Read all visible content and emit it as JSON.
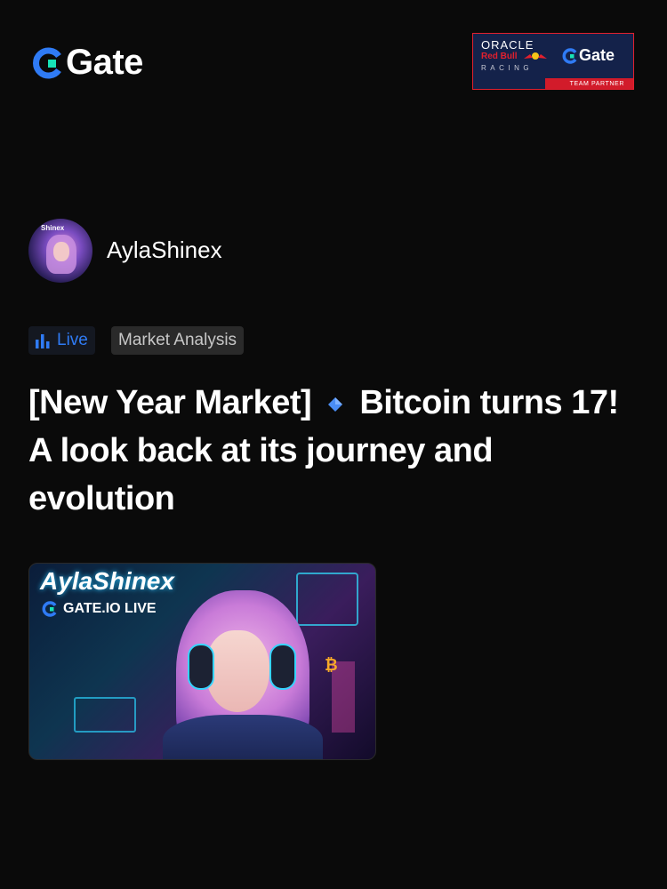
{
  "header": {
    "logo_text": "Gate",
    "partner": {
      "oracle": "ORACLE",
      "redbull": "Red Bull",
      "racing": "RACING",
      "gate": "Gate",
      "team_partner": "TEAM PARTNER"
    }
  },
  "author": {
    "name": "AylaShinex",
    "avatar_tag": "Shinex"
  },
  "tags": {
    "live": "Live",
    "category": "Market Analysis"
  },
  "post": {
    "title_part1": "[New Year Market]",
    "title_part2": "Bitcoin turns 17! A look back at its journey and evolution"
  },
  "thumbnail": {
    "title": "AylaShinex",
    "live_label": "GATE.IO LIVE"
  },
  "colors": {
    "background": "#0a0a0a",
    "brand_blue": "#2f7bf5",
    "brand_teal": "#17e3b7",
    "partner_red": "#e2202e",
    "partner_navy": "#14224a"
  },
  "icons": [
    "gate-logo-icon",
    "bar-chart-icon",
    "diamond-icon",
    "bull-icon"
  ]
}
